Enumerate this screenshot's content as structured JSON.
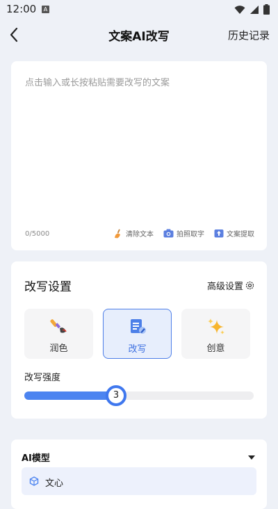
{
  "status": {
    "time": "12:00",
    "notification": "A"
  },
  "header": {
    "title": "文案AI改写",
    "history_label": "历史记录"
  },
  "input": {
    "placeholder": "点击输入或长按粘贴需要改写的文案",
    "char_count": "0/5000",
    "tools": [
      {
        "label": "清除文本",
        "icon": "broom-icon"
      },
      {
        "label": "拍照取字",
        "icon": "camera-icon"
      },
      {
        "label": "文案提取",
        "icon": "upload-icon"
      }
    ]
  },
  "settings": {
    "title": "改写设置",
    "advanced_label": "高级设置",
    "modes": [
      {
        "label": "润色",
        "icon": "paintbrush-icon",
        "selected": false
      },
      {
        "label": "改写",
        "icon": "document-edit-icon",
        "selected": true
      },
      {
        "label": "创意",
        "icon": "sparkle-icon",
        "selected": false
      }
    ],
    "strength_label": "改写强度",
    "strength": {
      "value": 3,
      "min": 1,
      "max": 6
    },
    "accent_color": "#4c84f0"
  },
  "model": {
    "title": "AI模型",
    "selected_label": "文心"
  }
}
